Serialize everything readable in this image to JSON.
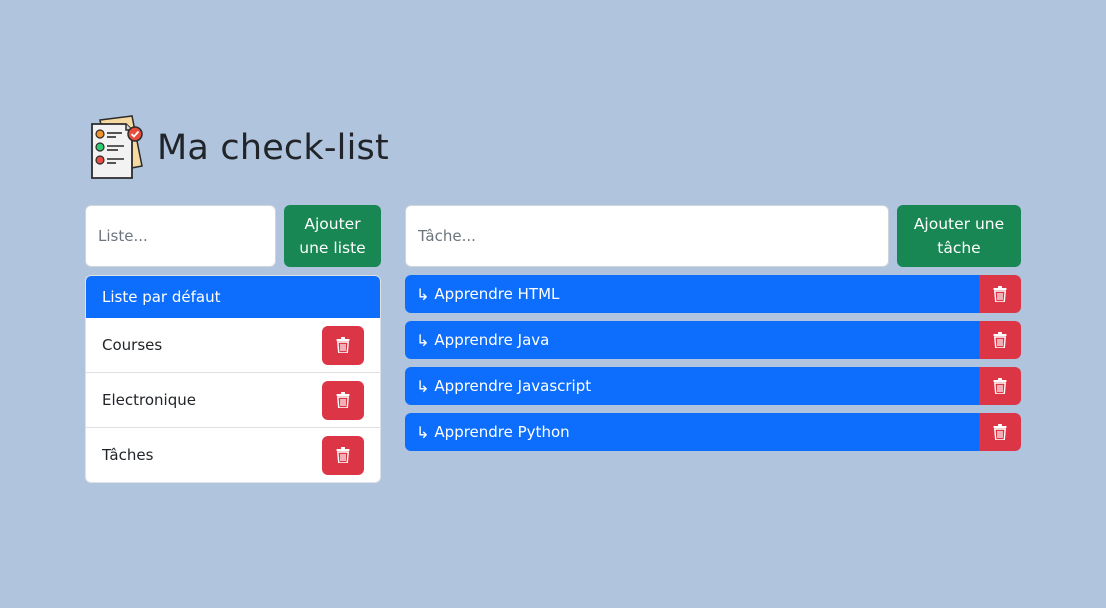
{
  "header": {
    "title": "Ma check-list",
    "logo_icon": "checklist-clipboard-icon"
  },
  "lists": {
    "input_placeholder": "Liste...",
    "input_value": "",
    "add_button_label": "Ajouter une liste",
    "active_item": "Liste par défaut",
    "items": [
      {
        "label": "Courses"
      },
      {
        "label": "Electronique"
      },
      {
        "label": "Tâches"
      }
    ]
  },
  "tasks": {
    "input_placeholder": "Tâche...",
    "input_value": "",
    "add_button_label": "Ajouter une tâche",
    "arrow_glyph": "↳",
    "items": [
      {
        "label": "Apprendre HTML"
      },
      {
        "label": "Apprendre Java"
      },
      {
        "label": "Apprendre Javascript"
      },
      {
        "label": "Apprendre Python"
      }
    ]
  },
  "colors": {
    "background": "#b0c4de",
    "primary": "#0d6efd",
    "success": "#198754",
    "danger": "#dc3545"
  }
}
